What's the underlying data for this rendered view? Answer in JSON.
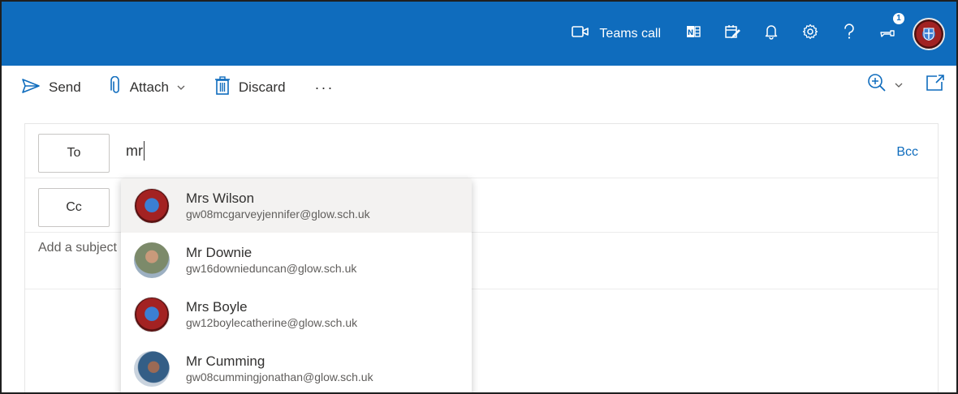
{
  "header": {
    "teams_call_label": "Teams call",
    "notification_count": "1",
    "icons": [
      "video-icon",
      "onenote-icon",
      "todo-icon",
      "bell-icon",
      "gear-icon",
      "help-icon",
      "feedback-icon"
    ]
  },
  "toolbar": {
    "send_label": "Send",
    "attach_label": "Attach",
    "discard_label": "Discard",
    "more_label": "···"
  },
  "compose": {
    "to_label": "To",
    "to_value": "mr",
    "bcc_label": "Bcc",
    "cc_label": "Cc",
    "subject_placeholder": "Add a subject"
  },
  "suggestions": [
    {
      "name": "Mrs Wilson",
      "email": "gw08mcgarveyjennifer@glow.sch.uk",
      "avatar": "crest"
    },
    {
      "name": "Mr Downie",
      "email": "gw16downieduncan@glow.sch.uk",
      "avatar": "photo"
    },
    {
      "name": "Mrs Boyle",
      "email": "gw12boylecatherine@glow.sch.uk",
      "avatar": "crest"
    },
    {
      "name": "Mr Cumming",
      "email": "gw08cummingjonathan@glow.sch.uk",
      "avatar": "photo"
    }
  ],
  "colors": {
    "brand_blue": "#0f6cbd",
    "text": "#323130",
    "muted": "#605e5c",
    "highlight_row": "#f3f2f1"
  }
}
